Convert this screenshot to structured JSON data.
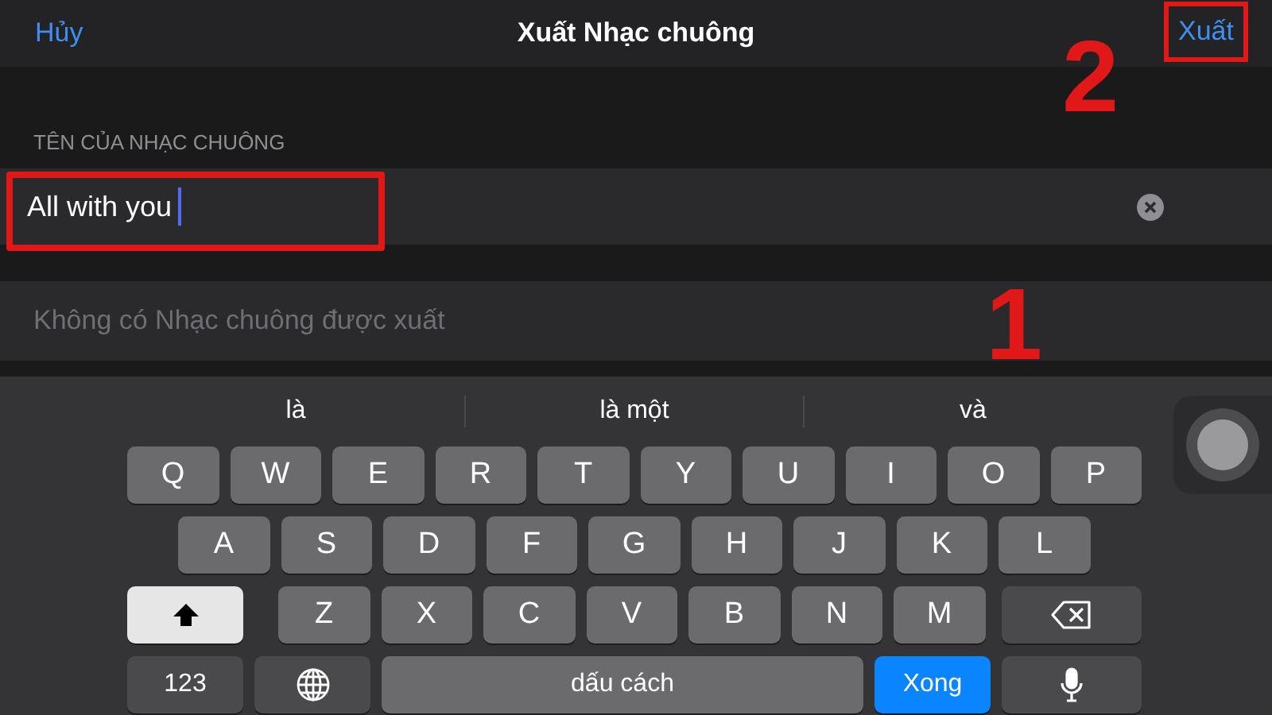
{
  "nav": {
    "cancel": "Hủy",
    "title": "Xuất Nhạc chuông",
    "export": {
      "label": "Xuất",
      "highlighted": true
    }
  },
  "section_header": "TÊN CỦA NHẠC CHUÔNG",
  "name_field": {
    "value": "All with you",
    "focused": true,
    "highlighted": true
  },
  "status_row": "Không có Nhạc chuông được xuất",
  "annotations": [
    {
      "label": "1"
    },
    {
      "label": "2"
    }
  ],
  "keyboard": {
    "suggestions": [
      "là",
      "là một",
      "và"
    ],
    "rows": [
      {
        "keys": [
          {
            "kind": "letter",
            "label": "Q"
          },
          {
            "kind": "letter",
            "label": "W"
          },
          {
            "kind": "letter",
            "label": "E"
          },
          {
            "kind": "letter",
            "label": "R"
          },
          {
            "kind": "letter",
            "label": "T"
          },
          {
            "kind": "letter",
            "label": "Y"
          },
          {
            "kind": "letter",
            "label": "U"
          },
          {
            "kind": "letter",
            "label": "I"
          },
          {
            "kind": "letter",
            "label": "O"
          },
          {
            "kind": "letter",
            "label": "P"
          }
        ]
      },
      {
        "keys": [
          {
            "kind": "letter",
            "label": "A"
          },
          {
            "kind": "letter",
            "label": "S"
          },
          {
            "kind": "letter",
            "label": "D"
          },
          {
            "kind": "letter",
            "label": "F"
          },
          {
            "kind": "letter",
            "label": "G"
          },
          {
            "kind": "letter",
            "label": "H"
          },
          {
            "kind": "letter",
            "label": "J"
          },
          {
            "kind": "letter",
            "label": "K"
          },
          {
            "kind": "letter",
            "label": "L"
          }
        ]
      },
      {
        "keys": [
          {
            "kind": "shift",
            "on": true
          },
          {
            "kind": "letter",
            "label": "Z"
          },
          {
            "kind": "letter",
            "label": "X"
          },
          {
            "kind": "letter",
            "label": "C"
          },
          {
            "kind": "letter",
            "label": "V"
          },
          {
            "kind": "letter",
            "label": "B"
          },
          {
            "kind": "letter",
            "label": "N"
          },
          {
            "kind": "letter",
            "label": "M"
          },
          {
            "kind": "delete"
          }
        ]
      },
      {
        "keys": [
          {
            "kind": "numbers",
            "label": "123"
          },
          {
            "kind": "globe"
          },
          {
            "kind": "space",
            "label": "dấu cách"
          },
          {
            "kind": "done",
            "label": "Xong"
          },
          {
            "kind": "mic"
          }
        ]
      }
    ]
  }
}
